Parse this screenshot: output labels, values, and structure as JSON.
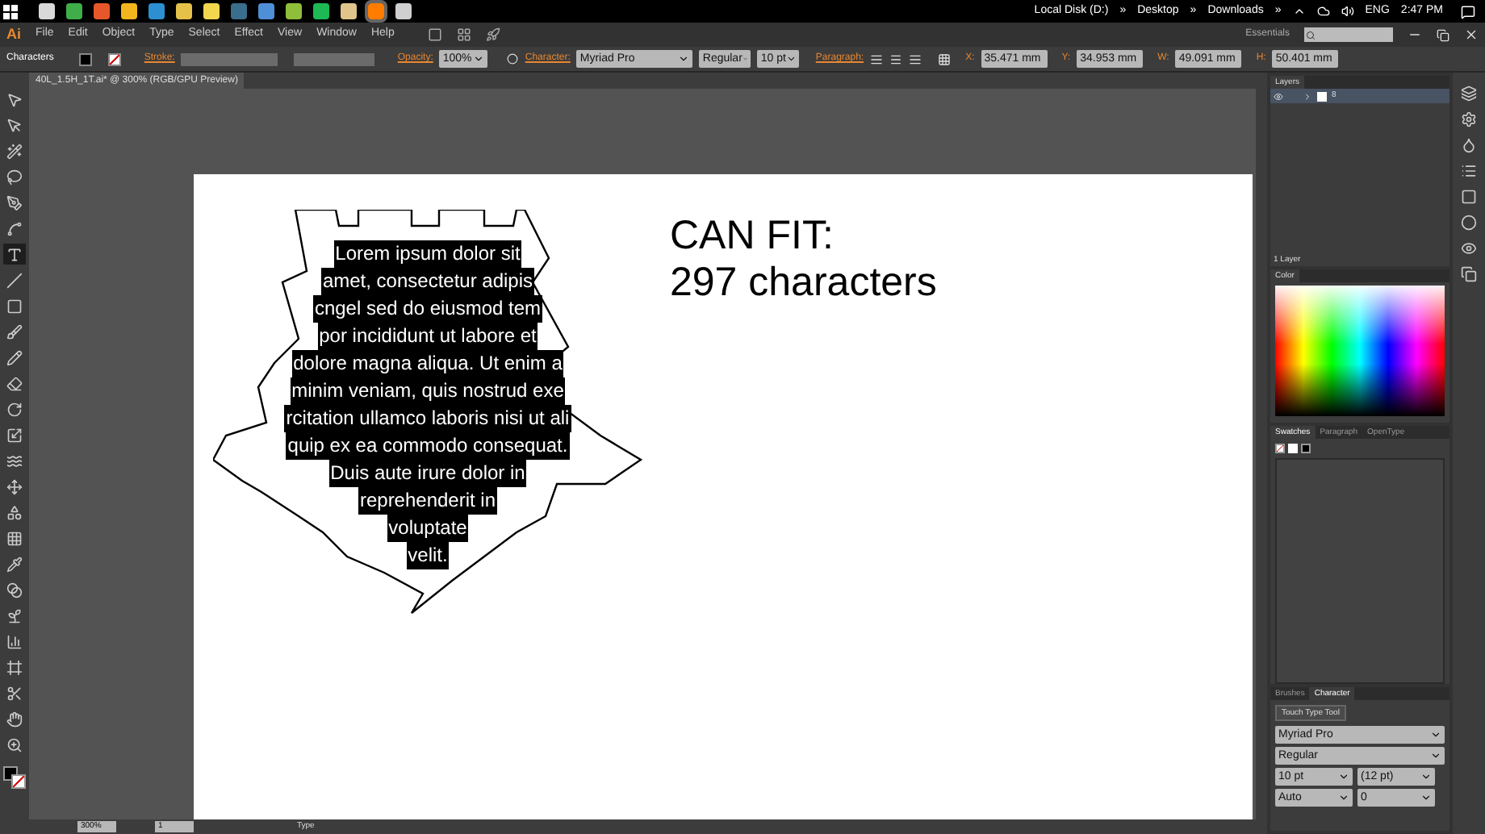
{
  "taskbar": {
    "apps": [
      {
        "color": "#d9d9d9",
        "selected": false
      },
      {
        "color": "#3fae49",
        "selected": false
      },
      {
        "color": "#e8572a",
        "selected": false
      },
      {
        "color": "#f2b51e",
        "selected": false
      },
      {
        "color": "#2c8fd1",
        "selected": false
      },
      {
        "color": "#e6c14a",
        "selected": false
      },
      {
        "color": "#f3d64e",
        "selected": false
      },
      {
        "color": "#3b6d8c",
        "selected": false
      },
      {
        "color": "#4f8fd8",
        "selected": false
      },
      {
        "color": "#8fbf3a",
        "selected": false
      },
      {
        "color": "#1db954",
        "selected": false
      },
      {
        "color": "#e0c48a",
        "selected": false
      },
      {
        "color": "#ff7c00",
        "selected": true
      },
      {
        "color": "#cfcfcf",
        "selected": false
      }
    ],
    "breadcrumbs": [
      "Local Disk (D:)",
      "Desktop",
      "Downloads"
    ],
    "separator": "»",
    "language": "ENG",
    "time": "2:47 PM"
  },
  "menu_bar": {
    "logo": "Ai",
    "items": [
      "File",
      "Edit",
      "Object",
      "Type",
      "Select",
      "Effect",
      "View",
      "Window",
      "Help"
    ],
    "workspace": "Essentials"
  },
  "control_bar": {
    "selection": "Characters",
    "stroke_label": "Stroke:",
    "opacity_label": "Opacity:",
    "opacity": "100%",
    "character_label": "Character:",
    "font": "Myriad Pro",
    "style": "Regular",
    "size": "10 pt",
    "paragraph_label": "Paragraph:",
    "transform": [
      {
        "label": "X:",
        "value": "35.471 mm"
      },
      {
        "label": "Y:",
        "value": "34.953 mm"
      },
      {
        "label": "W:",
        "value": "49.091 mm"
      },
      {
        "label": "H:",
        "value": "50.401 mm"
      }
    ]
  },
  "tools": [
    {
      "kind": "select",
      "selected": false
    },
    {
      "kind": "direct",
      "selected": false
    },
    {
      "kind": "wand",
      "selected": false
    },
    {
      "kind": "lasso",
      "selected": false
    },
    {
      "kind": "pen",
      "selected": false
    },
    {
      "kind": "curvature",
      "selected": false
    },
    {
      "kind": "type",
      "selected": true
    },
    {
      "kind": "line",
      "selected": false
    },
    {
      "kind": "rect",
      "selected": false
    },
    {
      "kind": "brush",
      "selected": false
    },
    {
      "kind": "pencil",
      "selected": false
    },
    {
      "kind": "eraser",
      "selected": false
    },
    {
      "kind": "rotate",
      "selected": false
    },
    {
      "kind": "scale",
      "selected": false
    },
    {
      "kind": "warp",
      "selected": false
    },
    {
      "kind": "free",
      "selected": false
    },
    {
      "kind": "shapes",
      "selected": false
    },
    {
      "kind": "mesh",
      "selected": false
    },
    {
      "kind": "eyedropper",
      "selected": false
    },
    {
      "kind": "blend",
      "selected": false
    },
    {
      "kind": "symbol",
      "selected": false
    },
    {
      "kind": "graph",
      "selected": false
    },
    {
      "kind": "artboard",
      "selected": false
    },
    {
      "kind": "slice",
      "selected": false
    },
    {
      "kind": "hand",
      "selected": false
    },
    {
      "kind": "zoom",
      "selected": false
    }
  ],
  "document": {
    "tab": "40L_1.5H_1T.ai* @ 300% (RGB/GPU Preview)",
    "text_lines": [
      "Lorem ipsum dolor sit",
      "amet, consectetur adipis",
      "cngel sed do eiusmod tem",
      "por incididunt ut labore et",
      "dolore magna aliqua. Ut enim a",
      "minim veniam, quis nostrud exe",
      "rcitation ullamco laboris nisi ut ali",
      "quip ex ea commodo consequat.",
      "Duis aute irure dolor in",
      "reprehenderit in",
      "voluptate",
      "velit."
    ],
    "heading": [
      "CAN FIT:",
      "297 characters"
    ]
  },
  "status_bar": {
    "zoom": "300%",
    "artboard": "1",
    "tool": "Type"
  },
  "layers": {
    "tab": "Layers",
    "rows": [
      {
        "name": "8",
        "visible": true
      }
    ],
    "footer": "1 Layer"
  },
  "color": {
    "tab": "Color"
  },
  "swatches": {
    "tabs": [
      {
        "label": "Swatches",
        "selected": true
      },
      {
        "label": "Paragraph",
        "selected": false
      },
      {
        "label": "OpenType",
        "selected": false
      }
    ]
  },
  "character": {
    "tabs": [
      {
        "label": "Brushes",
        "selected": false
      },
      {
        "label": "Character",
        "selected": true
      }
    ],
    "touch_type": "Touch Type Tool",
    "font": "Myriad Pro",
    "style": "Regular",
    "size": "10 pt",
    "leading": "(12 pt)",
    "kerning": "Auto",
    "tracking": "0"
  }
}
